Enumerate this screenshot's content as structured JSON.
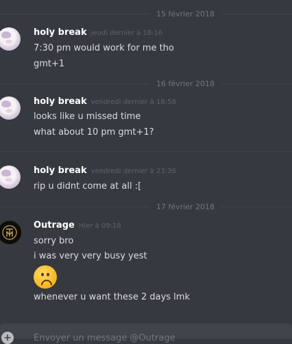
{
  "dividers": [
    "15 février 2018",
    "16 février 2018",
    "17 février 2018"
  ],
  "messages": [
    {
      "author": "holy break",
      "timestamp": "jeudi dernier à 18:16",
      "lines": [
        "7:30 pm would work for me tho",
        "gmt+1"
      ]
    },
    {
      "author": "holy break",
      "timestamp": "vendredi dernier à 18:58",
      "lines": [
        "looks like u missed time",
        "what about 10 pm gmt+1?"
      ]
    },
    {
      "author": "holy break",
      "timestamp": "vendredi dernier à 23:36",
      "lines": [
        "rip u didnt come at all :["
      ]
    },
    {
      "author": "Outrage",
      "timestamp": "Hier à 09:18",
      "lines": [
        "sorry bro",
        "i was very very busy yest",
        "whenever u want these 2 days lmk"
      ],
      "emoji": "frowning-face-emoji"
    }
  ],
  "composer": {
    "plus_icon": "add-attachment-icon",
    "placeholder": "Envoyer un message @Outrage"
  },
  "colors": {
    "background": "#36393f",
    "username": "#ffffff",
    "timestamp": "#5f636a",
    "text": "#dcddde"
  }
}
